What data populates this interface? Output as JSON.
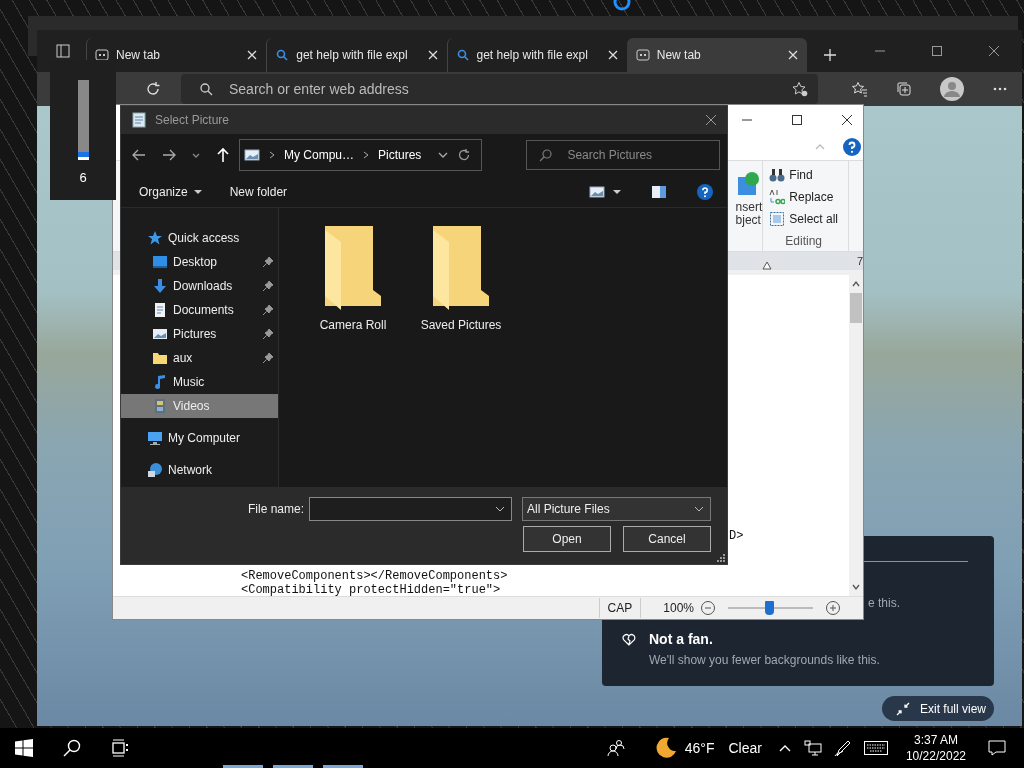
{
  "browser": {
    "tabs": [
      {
        "label": "New tab",
        "kind": "page",
        "selected": false
      },
      {
        "label": "get help with file expl",
        "kind": "search",
        "selected": false
      },
      {
        "label": "get help with file expl",
        "kind": "search",
        "selected": false
      },
      {
        "label": "New tab",
        "kind": "page",
        "selected": true
      }
    ],
    "address": {
      "placeholder": "Search or enter web address"
    }
  },
  "volume": {
    "level": 0.06,
    "reading": "6"
  },
  "wordpad": {
    "insert_label": [
      "nsert",
      "bject"
    ],
    "editing": {
      "items": [
        {
          "label": "Find",
          "kind": "find"
        },
        {
          "label": "Replace",
          "kind": "replace"
        },
        {
          "label": "Select all",
          "kind": "select"
        }
      ],
      "group": "Editing"
    },
    "ruler_mark": "7",
    "lines": [
      "D>",
      "<RemoveComponents></RemoveComponents>",
      "<Compatibility protectHidden=\"true\">"
    ],
    "status": {
      "caps": "CAP",
      "zoom": "100%",
      "level": 0.48
    }
  },
  "dialog": {
    "title": "Select Picture",
    "breadcrumb": [
      "My Compu…",
      "Pictures"
    ],
    "search": {
      "placeholder": "Search Pictures"
    },
    "toolbar": [
      "Organize",
      "New folder"
    ],
    "nav_pane": [
      {
        "label": "Quick access",
        "kind": "star",
        "selected": false,
        "children": [
          {
            "label": "Desktop",
            "kind": "desktop",
            "pinned": true,
            "selected": false
          },
          {
            "label": "Downloads",
            "kind": "download",
            "pinned": true,
            "selected": false
          },
          {
            "label": "Documents",
            "kind": "document",
            "pinned": true,
            "selected": false
          },
          {
            "label": "Pictures",
            "kind": "picture",
            "pinned": true,
            "selected": false
          },
          {
            "label": "aux",
            "kind": "folder",
            "pinned": true,
            "selected": false
          },
          {
            "label": "Music",
            "kind": "music",
            "pinned": false,
            "selected": false
          },
          {
            "label": "Videos",
            "kind": "video",
            "pinned": false,
            "selected": true
          }
        ]
      },
      {
        "label": "My Computer",
        "kind": "computer",
        "selected": false
      },
      {
        "label": "Network",
        "kind": "network",
        "selected": false
      }
    ],
    "folders": [
      "Camera Roll",
      "Saved Pictures"
    ],
    "file_name": {
      "label": "File name:"
    },
    "filter": "All Picture Files",
    "buttons": [
      "Open",
      "Cancel"
    ]
  },
  "notification": {
    "partial": "e this.",
    "title": "Not a fan.",
    "body": "We'll show you fewer backgrounds like this."
  },
  "exit_full_view": "Exit full view",
  "taskbar": {
    "weather": {
      "temp": "46°F",
      "condition": "Clear"
    },
    "time": "3:37 AM",
    "date": "10/22/2022"
  }
}
